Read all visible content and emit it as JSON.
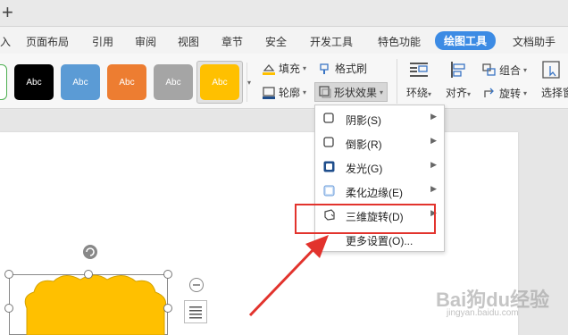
{
  "window": {
    "new_tab_glyph": "+"
  },
  "menu_tabs": [
    {
      "label": "入",
      "active": false
    },
    {
      "label": "页面布局",
      "active": false
    },
    {
      "label": "引用",
      "active": false
    },
    {
      "label": "审阅",
      "active": false
    },
    {
      "label": "视图",
      "active": false
    },
    {
      "label": "章节",
      "active": false
    },
    {
      "label": "安全",
      "active": false
    },
    {
      "label": "开发工具",
      "active": false
    },
    {
      "label": "特色功能",
      "active": false
    },
    {
      "label": "绘图工具",
      "active": true
    },
    {
      "label": "文档助手",
      "active": false
    }
  ],
  "ribbon": {
    "styles": [
      {
        "label": "Abc",
        "bg": "#000000",
        "fg": "#ffffff"
      },
      {
        "label": "Abc",
        "bg": "#5b9bd5",
        "fg": "#ffffff"
      },
      {
        "label": "Abc",
        "bg": "#ed7d31",
        "fg": "#ffffff"
      },
      {
        "label": "Abc",
        "bg": "#a5a5a5",
        "fg": "#ffffff"
      },
      {
        "label": "Abc",
        "bg": "#ffc000",
        "fg": "#ffffff"
      }
    ],
    "fill_label": "填充",
    "format_painter_label": "格式刷",
    "outline_label": "轮廓",
    "shape_effects_label": "形状效果",
    "wrap_label": "环绕",
    "align_label": "对齐",
    "group_label": "组合",
    "rotate_label": "旋转",
    "select_pane_label": "选择窗"
  },
  "effects_menu": {
    "items": [
      {
        "label": "阴影(S)",
        "icon": "shadow-icon",
        "submenu": true
      },
      {
        "label": "倒影(R)",
        "icon": "reflection-icon",
        "submenu": true
      },
      {
        "label": "发光(G)",
        "icon": "glow-icon",
        "submenu": true
      },
      {
        "label": "柔化边缘(E)",
        "icon": "soft-edges-icon",
        "submenu": true
      },
      {
        "label": "三维旋转(D)",
        "icon": "3d-rotation-icon",
        "submenu": true
      },
      {
        "label": "更多设置(O)...",
        "icon": "",
        "submenu": false
      }
    ],
    "submenu_arrow": "▶"
  },
  "shape_fill_color": "#ffc000",
  "watermark": {
    "logo": "Bai狗du经验",
    "url": "jingyan.baidu.com"
  },
  "colors": {
    "accent": "#3c8be4",
    "annotation": "#e2332d"
  }
}
